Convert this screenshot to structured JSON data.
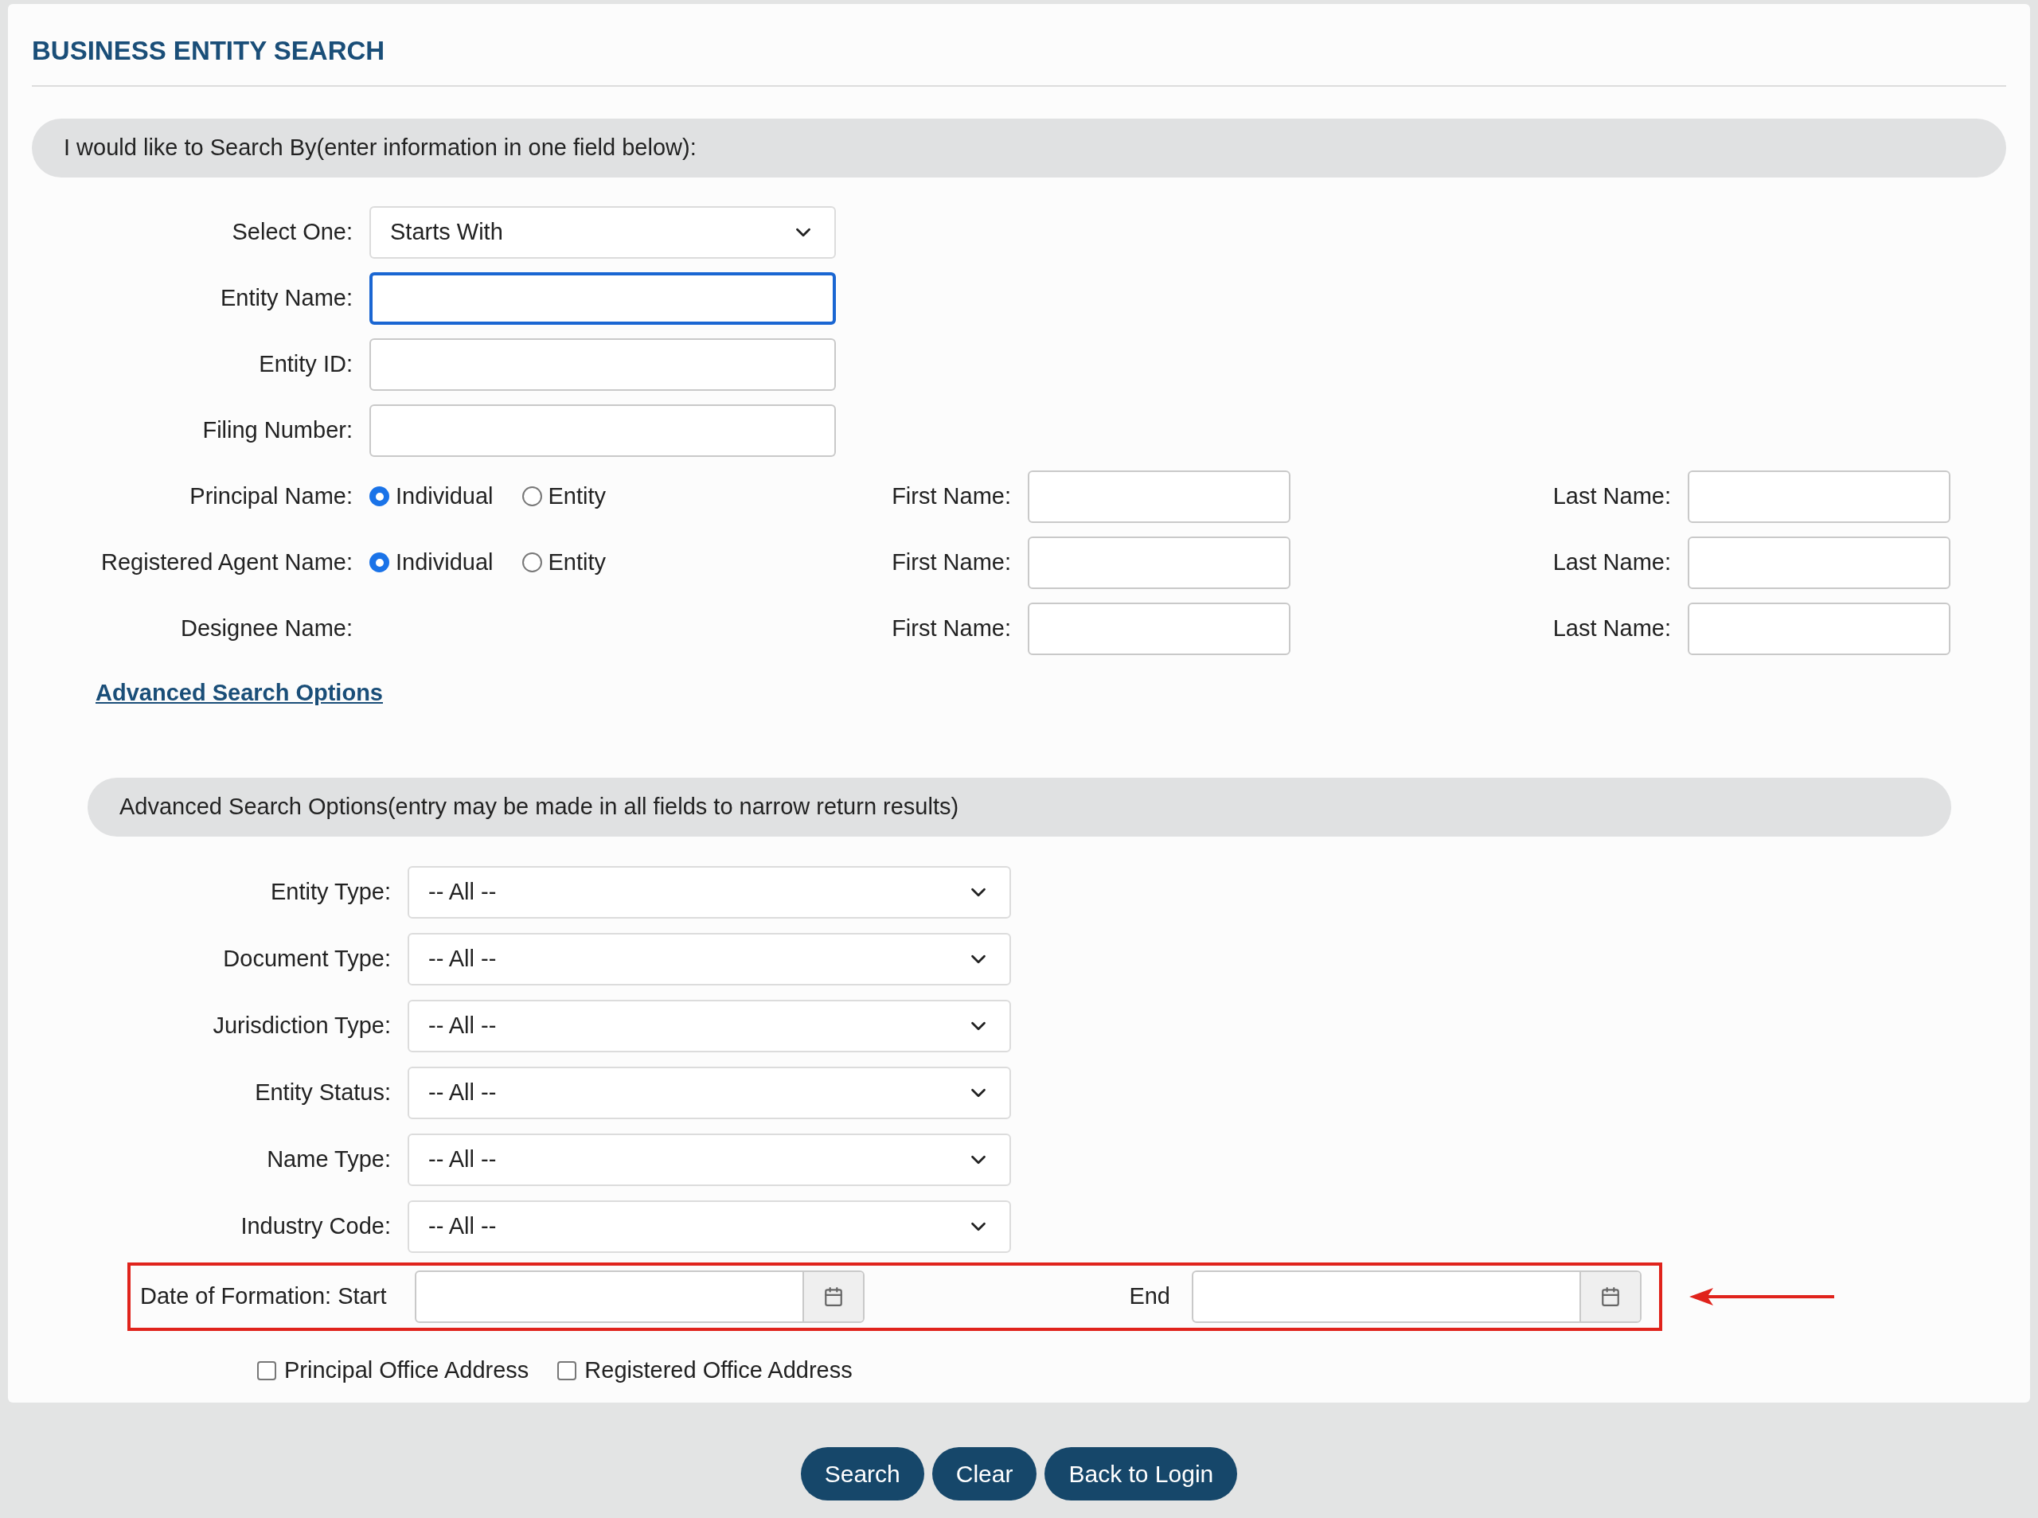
{
  "title": "BUSINESS ENTITY SEARCH",
  "search_by": {
    "heading": "I would like to Search By(enter information in one field below):",
    "select_one": {
      "label": "Select One:",
      "value": "Starts With"
    },
    "fields": [
      {
        "label": "Entity Name:",
        "focused": true
      },
      {
        "label": "Entity ID:",
        "focused": false
      },
      {
        "label": "Filing Number:",
        "focused": false
      }
    ],
    "name_rows": [
      {
        "label": "Principal Name:",
        "options": [
          {
            "label": "Individual",
            "selected": true
          },
          {
            "label": "Entity",
            "selected": false
          }
        ],
        "first_name_label": "First Name:",
        "last_name_label": "Last Name:"
      },
      {
        "label": "Registered Agent Name:",
        "options": [
          {
            "label": "Individual",
            "selected": true
          },
          {
            "label": "Entity",
            "selected": false
          }
        ],
        "first_name_label": "First Name:",
        "last_name_label": "Last Name:"
      },
      {
        "label": "Designee Name:",
        "first_name_label": "First Name:",
        "last_name_label": "Last Name:"
      }
    ]
  },
  "advanced_link": "Advanced Search Options",
  "advanced": {
    "heading": "Advanced Search Options(entry may be made in all fields to narrow return results)",
    "selects": [
      {
        "label": "Entity Type:",
        "value": "-- All --"
      },
      {
        "label": "Document Type:",
        "value": "-- All --"
      },
      {
        "label": "Jurisdiction Type:",
        "value": "-- All --"
      },
      {
        "label": "Entity Status:",
        "value": "-- All --"
      },
      {
        "label": "Name Type:",
        "value": "-- All --"
      },
      {
        "label": "Industry Code:",
        "value": "-- All --"
      }
    ],
    "date_range": {
      "start_label": "Date of Formation: Start",
      "end_label": "End",
      "highlighted": true
    },
    "checkboxes": [
      {
        "label": "Principal Office Address",
        "checked": false
      },
      {
        "label": "Registered Office Address",
        "checked": false
      }
    ]
  },
  "buttons": [
    "Search",
    "Clear",
    "Back to Login"
  ]
}
